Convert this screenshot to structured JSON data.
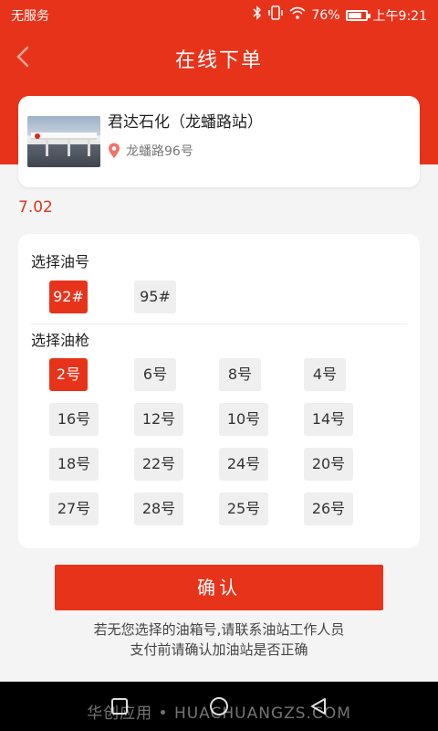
{
  "status_bar": {
    "carrier": "无服务",
    "icons": [
      "bluetooth-icon",
      "vibrate-icon",
      "wifi-icon"
    ],
    "battery_percent": "76%",
    "battery_level": 0.76,
    "time": "上午9:21"
  },
  "header": {
    "title": "在线下单",
    "back_icon": "chevron-left-icon",
    "background_color": "#e8331b"
  },
  "station": {
    "name": "君达石化（龙蟠路站）",
    "address": "龙蟠路96号",
    "address_icon": "location-pin-icon"
  },
  "price": "7.02",
  "fuel_section": {
    "title": "选择油号",
    "options": [
      {
        "label": "92#",
        "selected": true
      },
      {
        "label": "95#",
        "selected": false
      }
    ]
  },
  "nozzle_section": {
    "title": "选择油枪",
    "options": [
      {
        "label": "2号",
        "selected": true
      },
      {
        "label": "6号",
        "selected": false
      },
      {
        "label": "8号",
        "selected": false
      },
      {
        "label": "4号",
        "selected": false
      },
      {
        "label": "16号",
        "selected": false
      },
      {
        "label": "12号",
        "selected": false
      },
      {
        "label": "10号",
        "selected": false
      },
      {
        "label": "14号",
        "selected": false
      },
      {
        "label": "18号",
        "selected": false
      },
      {
        "label": "22号",
        "selected": false
      },
      {
        "label": "24号",
        "selected": false
      },
      {
        "label": "20号",
        "selected": false
      },
      {
        "label": "27号",
        "selected": false
      },
      {
        "label": "28号",
        "selected": false
      },
      {
        "label": "25号",
        "selected": false
      },
      {
        "label": "26号",
        "selected": false
      }
    ]
  },
  "confirm_button": "确认",
  "notice": {
    "line1": "若无您选择的油箱号,请联系油站工作人员",
    "line2": "支付前请确认加油站是否正确"
  },
  "nav_bar": {
    "icons": [
      "back-triangle-icon",
      "home-circle-icon",
      "recents-square-icon"
    ]
  },
  "watermark": "华创应用 • HUACHUANGZS.COM",
  "accent_color": "#e8331b"
}
